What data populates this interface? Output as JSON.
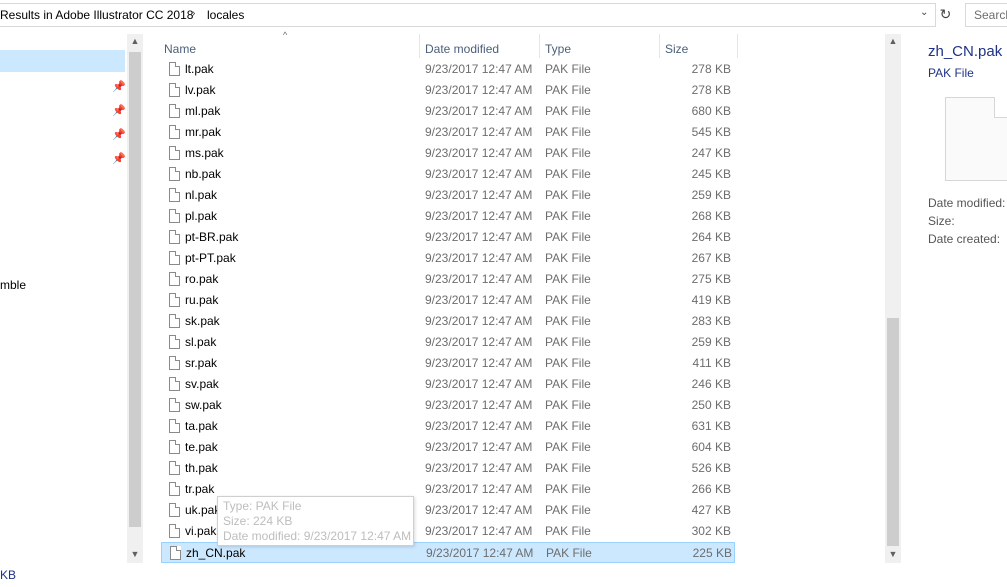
{
  "address": {
    "crumb_1": "Results in Adobe Illustrator CC 2018",
    "separator": "›",
    "crumb_2": "locales",
    "dropdown_glyph": "⌄",
    "refresh_glyph": "↻",
    "search_placeholder": "Search"
  },
  "nav": {
    "pin_glyph": "📌",
    "partial_item": "mble"
  },
  "columns": {
    "name": "Name",
    "date": "Date modified",
    "type": "Type",
    "size": "Size",
    "sort_glyph": "^"
  },
  "files": [
    {
      "name": "lt.pak",
      "date": "9/23/2017 12:47 AM",
      "type": "PAK File",
      "size": "278 KB"
    },
    {
      "name": "lv.pak",
      "date": "9/23/2017 12:47 AM",
      "type": "PAK File",
      "size": "278 KB"
    },
    {
      "name": "ml.pak",
      "date": "9/23/2017 12:47 AM",
      "type": "PAK File",
      "size": "680 KB"
    },
    {
      "name": "mr.pak",
      "date": "9/23/2017 12:47 AM",
      "type": "PAK File",
      "size": "545 KB"
    },
    {
      "name": "ms.pak",
      "date": "9/23/2017 12:47 AM",
      "type": "PAK File",
      "size": "247 KB"
    },
    {
      "name": "nb.pak",
      "date": "9/23/2017 12:47 AM",
      "type": "PAK File",
      "size": "245 KB"
    },
    {
      "name": "nl.pak",
      "date": "9/23/2017 12:47 AM",
      "type": "PAK File",
      "size": "259 KB"
    },
    {
      "name": "pl.pak",
      "date": "9/23/2017 12:47 AM",
      "type": "PAK File",
      "size": "268 KB"
    },
    {
      "name": "pt-BR.pak",
      "date": "9/23/2017 12:47 AM",
      "type": "PAK File",
      "size": "264 KB"
    },
    {
      "name": "pt-PT.pak",
      "date": "9/23/2017 12:47 AM",
      "type": "PAK File",
      "size": "267 KB"
    },
    {
      "name": "ro.pak",
      "date": "9/23/2017 12:47 AM",
      "type": "PAK File",
      "size": "275 KB"
    },
    {
      "name": "ru.pak",
      "date": "9/23/2017 12:47 AM",
      "type": "PAK File",
      "size": "419 KB"
    },
    {
      "name": "sk.pak",
      "date": "9/23/2017 12:47 AM",
      "type": "PAK File",
      "size": "283 KB"
    },
    {
      "name": "sl.pak",
      "date": "9/23/2017 12:47 AM",
      "type": "PAK File",
      "size": "259 KB"
    },
    {
      "name": "sr.pak",
      "date": "9/23/2017 12:47 AM",
      "type": "PAK File",
      "size": "411 KB"
    },
    {
      "name": "sv.pak",
      "date": "9/23/2017 12:47 AM",
      "type": "PAK File",
      "size": "246 KB"
    },
    {
      "name": "sw.pak",
      "date": "9/23/2017 12:47 AM",
      "type": "PAK File",
      "size": "250 KB"
    },
    {
      "name": "ta.pak",
      "date": "9/23/2017 12:47 AM",
      "type": "PAK File",
      "size": "631 KB"
    },
    {
      "name": "te.pak",
      "date": "9/23/2017 12:47 AM",
      "type": "PAK File",
      "size": "604 KB"
    },
    {
      "name": "th.pak",
      "date": "9/23/2017 12:47 AM",
      "type": "PAK File",
      "size": "526 KB"
    },
    {
      "name": "tr.pak",
      "date": "9/23/2017 12:47 AM",
      "type": "PAK File",
      "size": "266 KB"
    },
    {
      "name": "uk.pak",
      "date": "9/23/2017 12:47 AM",
      "type": "PAK File",
      "size": "427 KB"
    },
    {
      "name": "vi.pak",
      "date": "9/23/2017 12:47 AM",
      "type": "PAK File",
      "size": "302 KB"
    },
    {
      "name": "zh_CN.pak",
      "date": "9/23/2017 12:47 AM",
      "type": "PAK File",
      "size": "225 KB",
      "selected": true
    }
  ],
  "tooltip": {
    "type_line": "Type: PAK File",
    "size_line": "Size: 224 KB",
    "date_line": "Date modified: 9/23/2017 12:47 AM"
  },
  "scroll": {
    "up_glyph": "▲",
    "down_glyph": "▼"
  },
  "preview": {
    "name": "zh_CN.pak",
    "type": "PAK File",
    "date_modified_label": "Date modified:",
    "size_label": "Size:",
    "date_created_label": "Date created:"
  },
  "status": {
    "text": "KB"
  },
  "colors": {
    "selection_bg": "#cce8ff",
    "selection_border": "#99d1ff",
    "header_text": "#4c607a",
    "link_text": "#1e3287"
  }
}
